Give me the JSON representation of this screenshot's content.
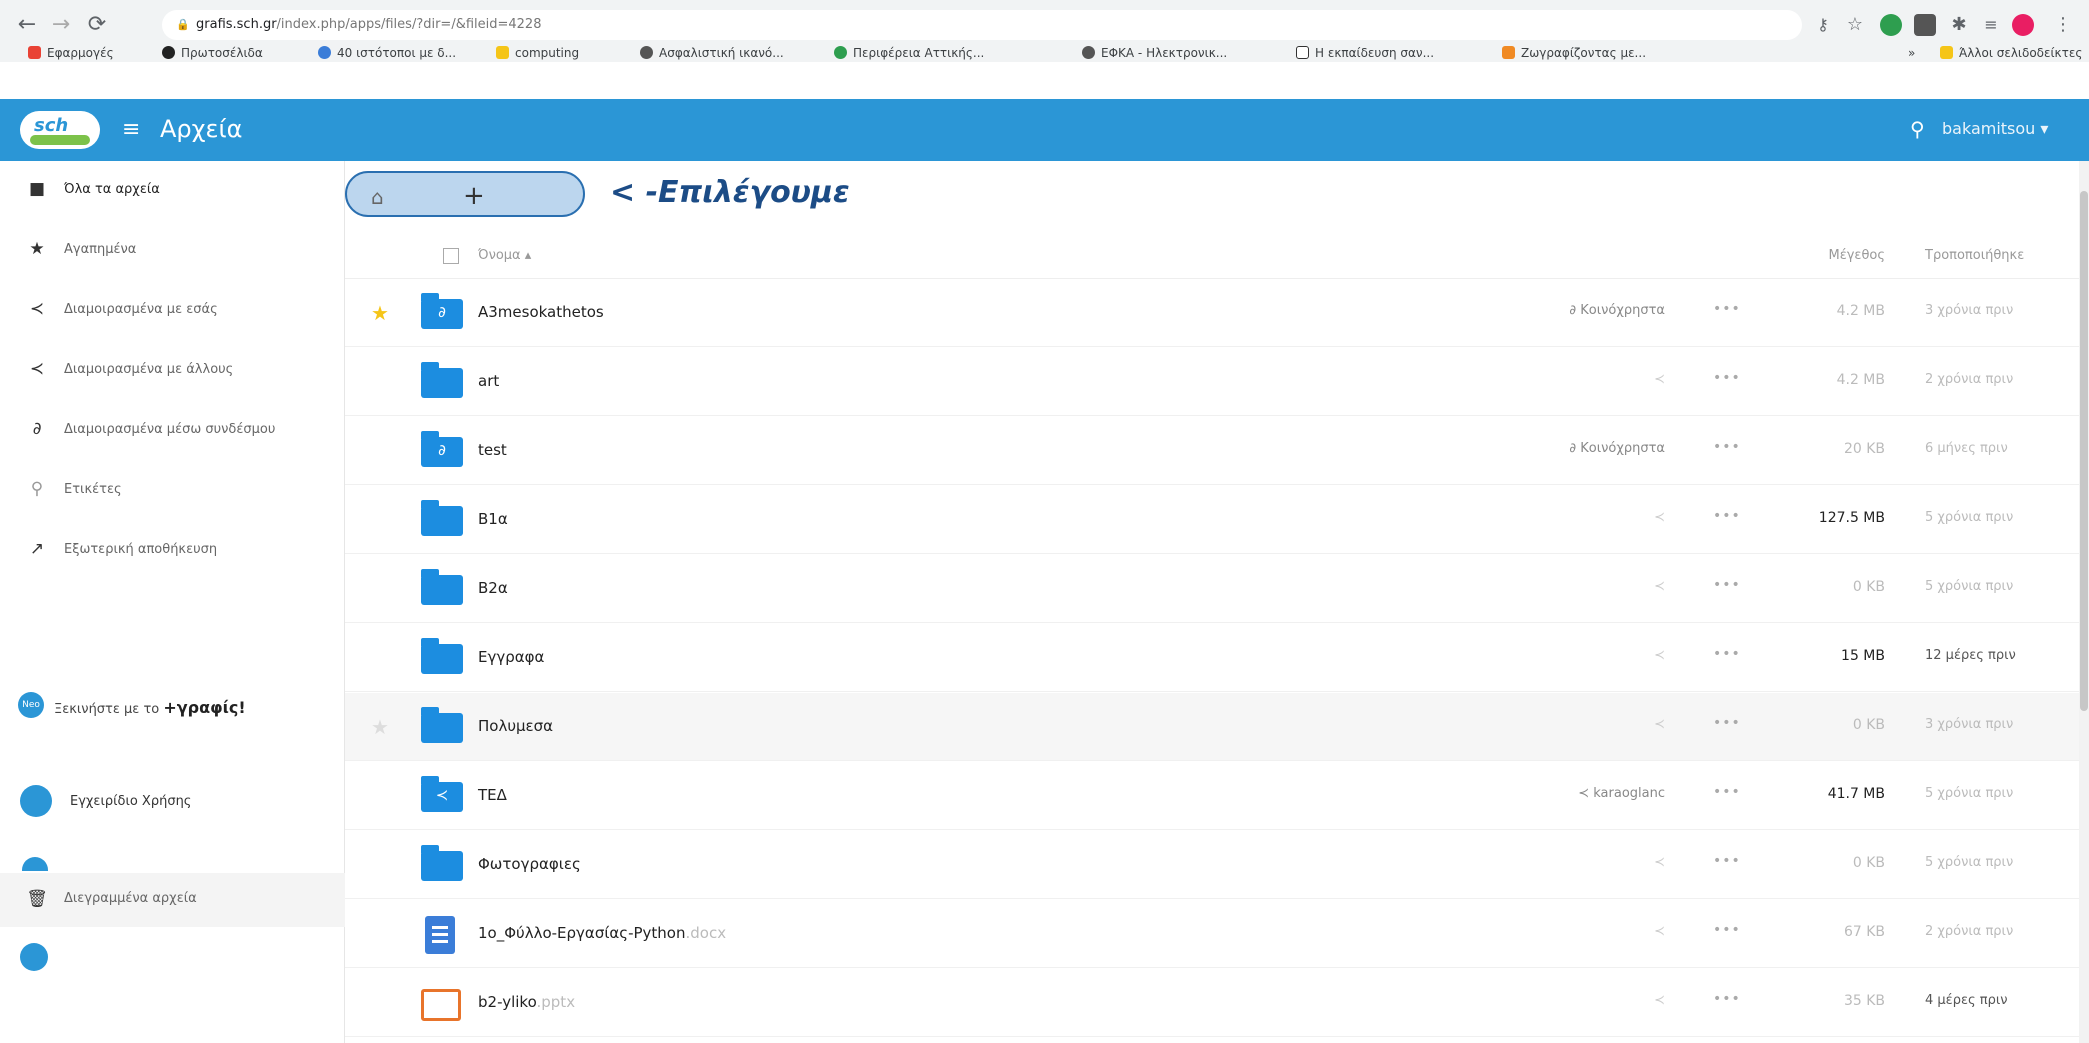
{
  "browser": {
    "url_host": "grafis.sch.gr",
    "url_path": "/index.php/apps/files/?dir=/&fileid=4228",
    "bookmarks": [
      {
        "label": "Εφαρμογές",
        "color": "#e94235"
      },
      {
        "label": "Πρωτοσέλιδα",
        "color": "#222222"
      },
      {
        "label": "40 ιστότοποι με δ...",
        "color": "#3b7dd8"
      },
      {
        "label": "computing",
        "color": "#f5c518"
      },
      {
        "label": "Ασφαλιστική ικανό...",
        "color": "#555555"
      },
      {
        "label": "Περιφέρεια Αττικής...",
        "color": "#2e9e4f"
      },
      {
        "label": "ΕΦΚΑ - Ηλεκτρονικ...",
        "color": "#555555"
      },
      {
        "label": "Η εκπαίδευση σαν...",
        "color": "#333333"
      },
      {
        "label": "Ζωγραφίζοντας με...",
        "color": "#f08a24"
      }
    ],
    "other_bookmarks": "Άλλοι σελιδοδείκτες",
    "more": "»"
  },
  "header": {
    "app_title": "Αρχεία",
    "logo_text": "sch",
    "user": "bakamitsou ▾"
  },
  "sidebar": {
    "items": [
      {
        "label": "Όλα τα αρχεία",
        "icon": "folder-icon"
      },
      {
        "label": "Αγαπημένα",
        "icon": "star-icon"
      },
      {
        "label": "Διαμοιρασμένα με εσάς",
        "icon": "share-icon"
      },
      {
        "label": "Διαμοιρασμένα με άλλους",
        "icon": "share-icon"
      },
      {
        "label": "Διαμοιρασμένα μέσω συνδέσμου",
        "icon": "link-icon"
      },
      {
        "label": "Ετικέτες",
        "icon": "tag-icon"
      },
      {
        "label": "Εξωτερική αποθήκευση",
        "icon": "external-storage-icon"
      }
    ],
    "promo_prefix": "Ξεκινήστε με το ",
    "promo_brand": "+γραφίς!",
    "promo_badge": "Neo",
    "manual": "Εγχειρίδιο Χρήσης",
    "trash": "Διεγραμμένα αρχεία"
  },
  "toolbar": {
    "add": "+",
    "annotation": "< -Επιλέγουμε"
  },
  "columns": {
    "name": "Όνομα ▴",
    "size": "Μέγεθος",
    "modified": "Τροποποιήθηκε"
  },
  "files": [
    {
      "name": "A3mesokathetos",
      "ext": "",
      "kind": "folder-link",
      "starred": true,
      "share": "Κοινόχρηστα",
      "share_kind": "link",
      "size": "4.2 MB",
      "size_color": "#bbbbbb",
      "modified": "3 χρόνια πριν",
      "mod_color": "#bbbbbb"
    },
    {
      "name": "art",
      "ext": "",
      "kind": "folder",
      "starred": false,
      "share": "",
      "share_kind": "none",
      "size": "4.2 MB",
      "size_color": "#bbbbbb",
      "modified": "2 χρόνια πριν",
      "mod_color": "#bbbbbb"
    },
    {
      "name": "test",
      "ext": "",
      "kind": "folder-link",
      "starred": false,
      "share": "Κοινόχρηστα",
      "share_kind": "link",
      "size": "20 KB",
      "size_color": "#bbbbbb",
      "modified": "6 μήνες πριν",
      "mod_color": "#bbbbbb"
    },
    {
      "name": "B1α",
      "ext": "",
      "kind": "folder",
      "starred": false,
      "share": "",
      "share_kind": "none",
      "size": "127.5 MB",
      "size_color": "#222222",
      "modified": "5 χρόνια πριν",
      "mod_color": "#bbbbbb"
    },
    {
      "name": "B2α",
      "ext": "",
      "kind": "folder",
      "starred": false,
      "share": "",
      "share_kind": "none",
      "size": "0 KB",
      "size_color": "#bbbbbb",
      "modified": "5 χρόνια πριν",
      "mod_color": "#bbbbbb"
    },
    {
      "name": "Εγγραφα",
      "ext": "",
      "kind": "folder",
      "starred": false,
      "share": "",
      "share_kind": "none",
      "size": "15 MB",
      "size_color": "#222222",
      "modified": "12 μέρες πριν",
      "mod_color": "#555555"
    },
    {
      "name": "Πολυμεσα",
      "ext": "",
      "kind": "folder",
      "starred": false,
      "share": "",
      "share_kind": "none",
      "size": "0 KB",
      "size_color": "#bbbbbb",
      "modified": "3 χρόνια πριν",
      "mod_color": "#bbbbbb"
    },
    {
      "name": "ΤΕΔ",
      "ext": "",
      "kind": "folder-shared",
      "starred": false,
      "share": "karaoglanc",
      "share_kind": "user",
      "size": "41.7 MB",
      "size_color": "#222222",
      "modified": "5 χρόνια πριν",
      "mod_color": "#bbbbbb"
    },
    {
      "name": "Φωτογραφιες",
      "ext": "",
      "kind": "folder",
      "starred": false,
      "share": "",
      "share_kind": "none",
      "size": "0 KB",
      "size_color": "#bbbbbb",
      "modified": "5 χρόνια πριν",
      "mod_color": "#bbbbbb"
    },
    {
      "name": "1ο_Φύλλο-Εργασίας-Python",
      "ext": ".docx",
      "kind": "docx",
      "starred": false,
      "share": "",
      "share_kind": "none",
      "size": "67 KB",
      "size_color": "#bbbbbb",
      "modified": "2 χρόνια πριν",
      "mod_color": "#bbbbbb"
    },
    {
      "name": "b2-yliko",
      "ext": ".pptx",
      "kind": "pptx",
      "starred": false,
      "share": "",
      "share_kind": "none",
      "size": "35 KB",
      "size_color": "#bbbbbb",
      "modified": "4 μέρες πριν",
      "mod_color": "#555555"
    }
  ]
}
